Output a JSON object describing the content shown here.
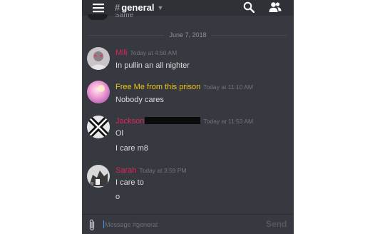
{
  "header": {
    "menu_icon": "hamburger-menu-icon",
    "channel_hash": "#",
    "channel_name": "general",
    "search_icon": "search-icon",
    "members_icon": "members-icon"
  },
  "cut_message": {
    "text": "Same"
  },
  "date_divider": "June 7, 2018",
  "messages": [
    {
      "username": "Mili",
      "username_color": "#e2245a",
      "timestamp": "Today at 4:50 AM",
      "lines": [
        "In pullin an all nighter"
      ]
    },
    {
      "username": "Free Me from this prison",
      "username_color": "#f1c40f",
      "timestamp": "Today at 11:10 AM",
      "lines": [
        "Nobody cares"
      ]
    },
    {
      "username": "Jackson",
      "username_color": "#e2245a",
      "timestamp": "Today at 11:53 AM",
      "lines": [
        "Ol",
        "I care m8"
      ]
    },
    {
      "username": "Sarah",
      "username_color": "#e2245a",
      "timestamp": "Today at 3:59 PM",
      "lines": [
        "I care to",
        "o"
      ]
    }
  ],
  "input": {
    "placeholder": "Message #general",
    "send_label": "Send",
    "attach_icon": "paperclip-icon"
  }
}
